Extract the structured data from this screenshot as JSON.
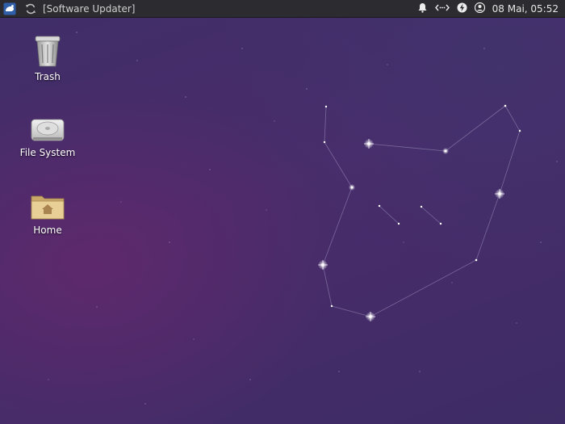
{
  "panel": {
    "task_title": "[Software Updater]",
    "clock": "08 Mai, 05:52",
    "tray_icons": [
      "notifications-icon",
      "network-icon",
      "power-icon",
      "user-icon"
    ]
  },
  "desktop": {
    "icons": [
      {
        "label": "Trash",
        "icon": "trash-icon"
      },
      {
        "label": "File System",
        "icon": "harddisk-icon"
      },
      {
        "label": "Home",
        "icon": "home-folder-icon"
      }
    ]
  },
  "colors": {
    "panel_bg": "#2b2b30",
    "desktop_base": "#45306a",
    "accent_blue": "#4a90d9"
  }
}
